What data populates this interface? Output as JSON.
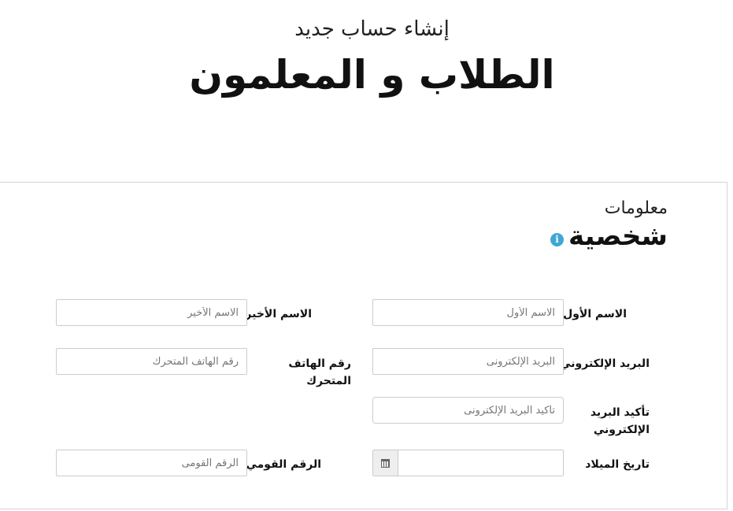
{
  "header": {
    "subtitle": "إنشاء حساب جديد",
    "title": "الطلاب و المعلمون"
  },
  "section": {
    "title_small": "معلومات",
    "title_big": "شخصية",
    "info_icon": "info-icon",
    "info_icon_glyph": "i"
  },
  "form": {
    "first_name": {
      "label": "الاسم الأول",
      "placeholder": "الاسم الأول"
    },
    "last_name": {
      "label": "الاسم الأخير",
      "placeholder": "الاسم الأخير"
    },
    "email": {
      "label": "البريد الإلكتروني",
      "placeholder": "البريد الإلكترونى"
    },
    "mobile": {
      "label": "رقم الهاتف المتحرك",
      "placeholder": "رقم الهاتف المتحرك"
    },
    "email_confirm": {
      "label_line1": "تأكيد البريد",
      "label_line2": "الإلكتروني",
      "placeholder": "تأكيد البريد الإلكترونى"
    },
    "birth_date": {
      "label": "تاريخ الميلاد",
      "placeholder": "",
      "icon": "calendar-icon"
    },
    "national_id": {
      "label": "الرقم القومي",
      "placeholder": "الرقم القومى"
    }
  },
  "colors": {
    "info_icon": "#3fa7d6",
    "input_border": "#cccccc",
    "addon_bg": "#eeeeee"
  }
}
